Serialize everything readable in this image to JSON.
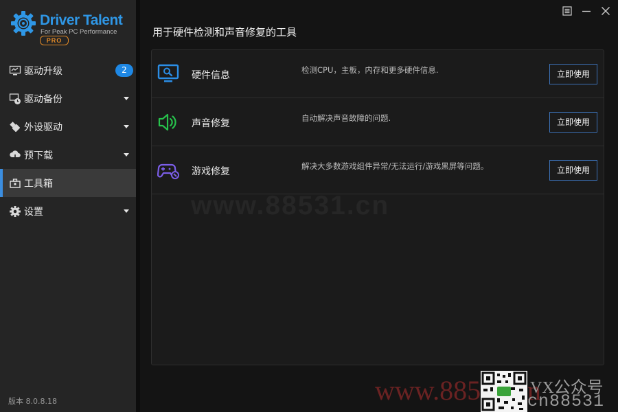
{
  "app": {
    "brand_title": "Driver Talent",
    "brand_subtitle": "For Peak PC Performance",
    "brand_edition": "PRO",
    "accent_color": "#2f97e6",
    "version_text": "版本 8.0.8.18"
  },
  "window_controls": {
    "menu_icon": "menu-icon",
    "minimize_icon": "minimize-icon",
    "close_icon": "close-icon"
  },
  "sidebar": {
    "items": [
      {
        "label": "驱动升级",
        "icon": "monitor-upgrade-icon",
        "badge": "2",
        "active": false
      },
      {
        "label": "驱动备份",
        "icon": "backup-clock-icon",
        "active": false,
        "expandable": true
      },
      {
        "label": "外设驱动",
        "icon": "usb-plug-icon",
        "active": false,
        "expandable": true
      },
      {
        "label": "预下载",
        "icon": "cloud-download-icon",
        "active": false,
        "expandable": true
      },
      {
        "label": "工具箱",
        "icon": "toolbox-icon",
        "active": true
      },
      {
        "label": "设置",
        "icon": "gear-icon",
        "active": false,
        "expandable": true
      }
    ]
  },
  "main": {
    "title": "用于硬件检测和声音修复的工具",
    "tools": [
      {
        "name": "硬件信息",
        "description": "检测CPU，主板，内存和更多硬件信息.",
        "button_label": "立即使用",
        "icon": "monitor-search-icon",
        "icon_color": "#2b8ee6"
      },
      {
        "name": "声音修复",
        "description": "自动解决声音故障的问题.",
        "button_label": "立即使用",
        "icon": "speaker-icon",
        "icon_color": "#27c24c"
      },
      {
        "name": "游戏修复",
        "description": "解决大多数游戏组件异常/无法运行/游戏黑屏等问题。",
        "button_label": "立即使用",
        "icon": "gamepad-icon",
        "icon_color": "#7b5ee8"
      }
    ]
  },
  "watermarks": {
    "center": "www.88531.cn",
    "bottom": "www.88531.cn",
    "qr_caption_line1": "VX公众号",
    "qr_caption_line2": "cn88531"
  }
}
